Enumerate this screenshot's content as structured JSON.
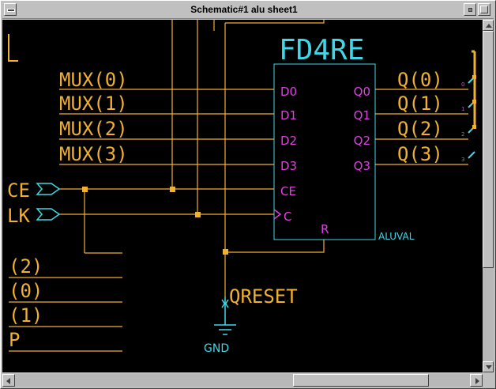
{
  "window": {
    "title": "Schematic#1 alu sheet1"
  },
  "schematic": {
    "component": {
      "name": "FD4RE",
      "instance": "ALUVAL",
      "pins_left": [
        "D0",
        "D1",
        "D2",
        "D3",
        "CE",
        "C"
      ],
      "pins_right": [
        "Q0",
        "Q1",
        "Q2",
        "Q3"
      ],
      "pin_bottom": "R"
    },
    "inputs": [
      "MUX(0)",
      "MUX(1)",
      "MUX(2)",
      "MUX(3)"
    ],
    "outputs": [
      "Q(0)",
      "Q(1)",
      "Q(2)",
      "Q(3)"
    ],
    "bus_taps": [
      "0",
      "1",
      "2",
      "3"
    ],
    "ports": [
      "CE",
      "LK"
    ],
    "bottom_labels": [
      "(2)",
      "(0)",
      "(1)",
      "P"
    ],
    "reset_net": "QRESET",
    "ground": "GND"
  },
  "colors": {
    "wire": "#f0b030",
    "component": "#e040e0",
    "label": "#f0b030",
    "cyan": "#40d8e8",
    "junction": "#f0b030"
  }
}
